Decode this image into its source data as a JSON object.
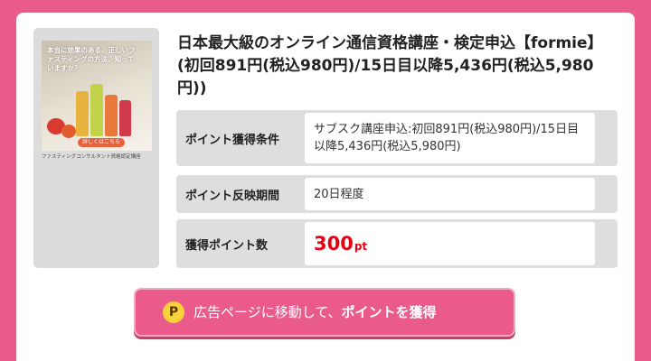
{
  "offer": {
    "title": "日本最大級のオンライン通信資格講座・検定申込【formie】(初回891円(税込980円)/15日目以降5,436円(税込5,980円))",
    "banner": {
      "headline": "本当に効果のある、正しいファスティングの方法、知っていますか？",
      "cta": "詳しくはこちら",
      "caption": "ファスティングコンサルタント資格認定講座"
    },
    "rows": [
      {
        "label": "ポイント獲得条件",
        "value": "サブスク講座申込:初回891円(税込980円)/15日目以降5,436円(税込5,980円)"
      },
      {
        "label": "ポイント反映期間",
        "value": "20日程度"
      },
      {
        "label": "獲得ポイント数",
        "points": "300",
        "unit": "pt"
      }
    ]
  },
  "cta_button": {
    "icon_letter": "P",
    "prefix": "広告ページに移動して、",
    "emphasis": "ポイントを獲得"
  },
  "colors": {
    "background": "#ea5b8c",
    "points": "#e60012",
    "cta": "#ea5b8c",
    "point_icon": "#f9d13b"
  }
}
